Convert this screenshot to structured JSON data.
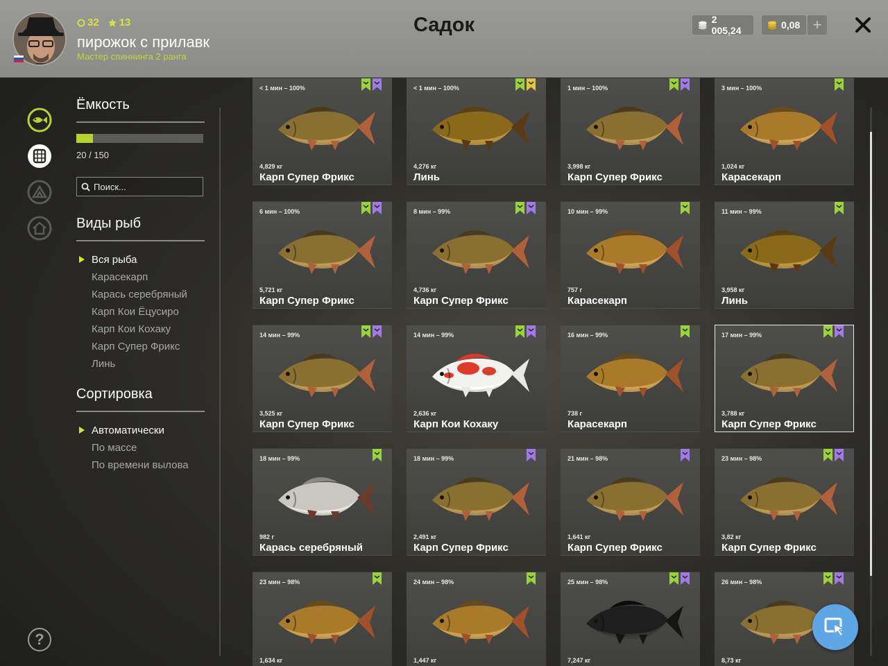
{
  "header": {
    "title": "Садок",
    "player": {
      "name": "пирожок с прилавк",
      "rank": "Мастер спиннинга 2 ранга",
      "level": "32",
      "stars": "13"
    },
    "currency": {
      "silver": "2 005,24",
      "gold": "0,08"
    },
    "plus_label": "+",
    "close_label": "✕"
  },
  "sidebar": {
    "capacity": {
      "title": "Ёмкость",
      "text": "20 / 150",
      "fill": 0.1333
    },
    "search": {
      "placeholder": "Поиск..."
    },
    "species": {
      "title": "Виды рыб",
      "items": [
        "Вся рыба",
        "Карасекарп",
        "Карась серебряный",
        "Карп Кои Ёцусиро",
        "Карп Кои Кохаку",
        "Карп Супер Фрикс",
        "Линь"
      ]
    },
    "sort": {
      "title": "Сортировка",
      "items": [
        "Автоматически",
        "По массе",
        "По времени вылова"
      ]
    },
    "help": "?"
  },
  "fish": [
    {
      "time": "< 1 мин – 100%",
      "weight": "4,829 кг",
      "name": "Карп Супер Фрикс",
      "kind": "carp",
      "badges": [
        "green",
        "purple"
      ]
    },
    {
      "time": "< 1 мин – 100%",
      "weight": "4,276 кг",
      "name": "Линь",
      "kind": "tench",
      "badges": [
        "green",
        "gold"
      ]
    },
    {
      "time": "1 мин – 100%",
      "weight": "3,998 кг",
      "name": "Карп Супер Фрикс",
      "kind": "carp",
      "badges": [
        "green",
        "purple"
      ]
    },
    {
      "time": "3 мин – 100%",
      "weight": "1,024 кг",
      "name": "Карасекарп",
      "kind": "crucian",
      "badges": [
        "green"
      ]
    },
    {
      "time": "6 мин – 100%",
      "weight": "5,721 кг",
      "name": "Карп Супер Фрикс",
      "kind": "carp",
      "badges": [
        "green",
        "purple"
      ]
    },
    {
      "time": "8 мин – 99%",
      "weight": "4,736 кг",
      "name": "Карп Супер Фрикс",
      "kind": "carp",
      "badges": [
        "green",
        "purple"
      ]
    },
    {
      "time": "10 мин – 99%",
      "weight": "757 г",
      "name": "Карасекарп",
      "kind": "crucian",
      "badges": [
        "green"
      ]
    },
    {
      "time": "11 мин – 99%",
      "weight": "3,958 кг",
      "name": "Линь",
      "kind": "tench",
      "badges": [
        "green"
      ]
    },
    {
      "time": "14 мин – 99%",
      "weight": "3,525 кг",
      "name": "Карп Супер Фрикс",
      "kind": "carp",
      "badges": [
        "green",
        "purple"
      ]
    },
    {
      "time": "14 мин – 99%",
      "weight": "2,636 кг",
      "name": "Карп Кои Кохаку",
      "kind": "koi",
      "badges": [
        "green",
        "purple"
      ]
    },
    {
      "time": "16 мин – 99%",
      "weight": "738 г",
      "name": "Карасекарп",
      "kind": "crucian",
      "badges": [
        "green"
      ]
    },
    {
      "time": "17 мин – 99%",
      "weight": "3,788 кг",
      "name": "Карп Супер Фрикс",
      "kind": "carp",
      "badges": [
        "green",
        "purple"
      ],
      "selected": true
    },
    {
      "time": "18 мин – 99%",
      "weight": "982 г",
      "name": "Карась серебряный",
      "kind": "silver",
      "badges": [
        "green"
      ]
    },
    {
      "time": "18 мин – 99%",
      "weight": "2,491 кг",
      "name": "Карп Супер Фрикс",
      "kind": "carp",
      "badges": [
        "purple"
      ]
    },
    {
      "time": "21 мин – 98%",
      "weight": "1,641 кг",
      "name": "Карп Супер Фрикс",
      "kind": "carp",
      "badges": [
        "purple"
      ]
    },
    {
      "time": "23 мин – 98%",
      "weight": "3,82 кг",
      "name": "Карп Супер Фрикс",
      "kind": "carp",
      "badges": [
        "green",
        "purple"
      ]
    },
    {
      "time": "23 мин – 98%",
      "weight": "1,634 кг",
      "name": "",
      "kind": "crucian",
      "badges": [
        "green"
      ]
    },
    {
      "time": "24 мин – 98%",
      "weight": "1,447 кг",
      "name": "",
      "kind": "crucian",
      "badges": [
        "green"
      ]
    },
    {
      "time": "25 мин – 98%",
      "weight": "7,247 кг",
      "name": "",
      "kind": "black",
      "badges": [
        "green",
        "purple"
      ]
    },
    {
      "time": "26 мин – 98%",
      "weight": "8,73 кг",
      "name": "",
      "kind": "carp",
      "badges": [
        "green",
        "purple"
      ]
    }
  ],
  "colors": {
    "accent": "#d4e43c",
    "badge_green": "#9bd33a",
    "badge_purple": "#a07ae6",
    "badge_gold": "#e6c43a",
    "fab": "#5ea6e6"
  }
}
